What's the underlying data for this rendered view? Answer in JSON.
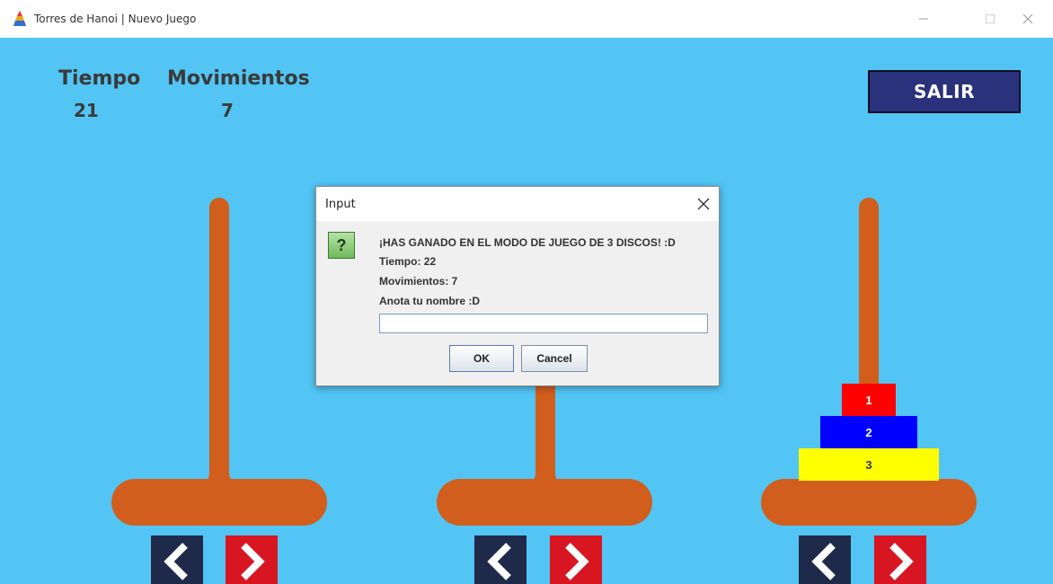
{
  "window": {
    "title": "Torres de Hanoi | Nuevo Juego"
  },
  "stats": {
    "time_label": "Tiempo",
    "time_value": "21",
    "moves_label": "Movimientos",
    "moves_value": "7"
  },
  "exit_button": "SALIR",
  "towers": [
    {
      "disks": []
    },
    {
      "disks": []
    },
    {
      "disks": [
        {
          "label": "1",
          "color": "#ff0000"
        },
        {
          "label": "2",
          "color": "#0000ff"
        },
        {
          "label": "3",
          "color": "#ffff00"
        }
      ]
    }
  ],
  "colors": {
    "background": "#52c5f4",
    "pole": "#d25e1d",
    "exit_button": "#2a327c",
    "arrow_left": "#1f2a4b",
    "arrow_right": "#d81622"
  },
  "dialog": {
    "title": "Input",
    "lines": [
      "¡HAS GANADO EN EL MODO DE JUEGO DE 3 DISCOS! :D",
      "Tiempo: 22",
      "Movimientos: 7",
      "Anota tu nombre :D"
    ],
    "input_value": "",
    "ok_label": "OK",
    "cancel_label": "Cancel",
    "icon": "question-icon",
    "icon_glyph": "?"
  }
}
